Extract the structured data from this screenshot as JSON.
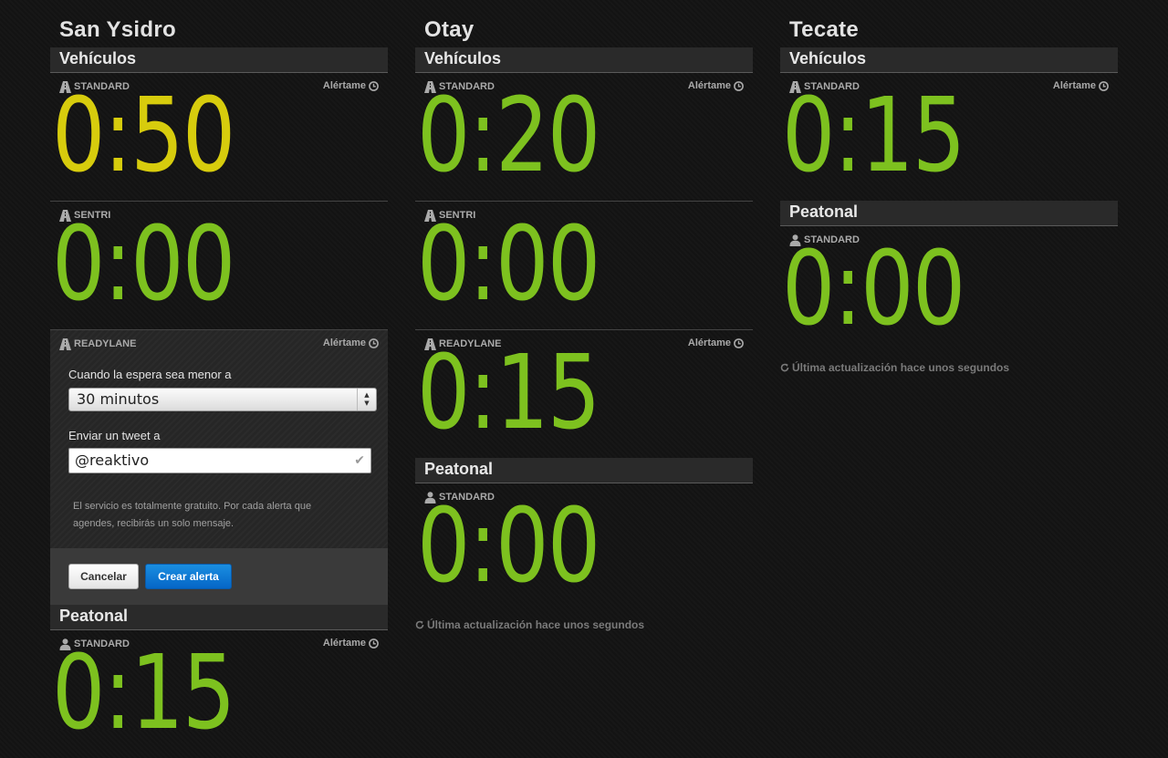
{
  "crossings": [
    {
      "name": "San Ysidro",
      "vehicles_header": "Vehículos",
      "standard": {
        "label": "STANDARD",
        "alert": "Alértame",
        "wait": "0:50",
        "color": "#d7cc0d"
      },
      "sentri": {
        "label": "SENTRI",
        "wait": "0:00"
      },
      "readylane": {
        "label": "READYLANE",
        "alert": "Alértame"
      },
      "alert_form": {
        "condition_label": "Cuando la espera sea menor a",
        "selected_option": "30 minutos",
        "tweet_label": "Enviar un tweet a",
        "tweet_value": "@reaktivo",
        "help_text": "El servicio es totalmente gratuito. Por cada alerta que agendes, recibirás un solo mensaje.",
        "cancel_label": "Cancelar",
        "create_label": "Crear alerta"
      },
      "pedestrian_header": "Peatonal",
      "pedestrian_standard": {
        "label": "STANDARD",
        "alert": "Alértame",
        "wait": "0:15"
      }
    },
    {
      "name": "Otay",
      "vehicles_header": "Vehículos",
      "standard": {
        "label": "STANDARD",
        "alert": "Alértame",
        "wait": "0:20"
      },
      "sentri": {
        "label": "SENTRI",
        "wait": "0:00"
      },
      "readylane": {
        "label": "READYLANE",
        "alert": "Alértame",
        "wait": "0:15"
      },
      "pedestrian_header": "Peatonal",
      "pedestrian_standard": {
        "label": "STANDARD",
        "wait": "0:00"
      },
      "last_update": "Última actualización hace unos segundos"
    },
    {
      "name": "Tecate",
      "vehicles_header": "Vehículos",
      "standard": {
        "label": "STANDARD",
        "alert": "Alértame",
        "wait": "0:15"
      },
      "pedestrian_header": "Peatonal",
      "pedestrian_standard": {
        "label": "STANDARD",
        "wait": "0:00"
      },
      "last_update": "Última actualización hace unos segundos"
    }
  ],
  "colors": {
    "ok": "#7dc11f",
    "warning": "#d7cc0d",
    "background": "#131313"
  }
}
